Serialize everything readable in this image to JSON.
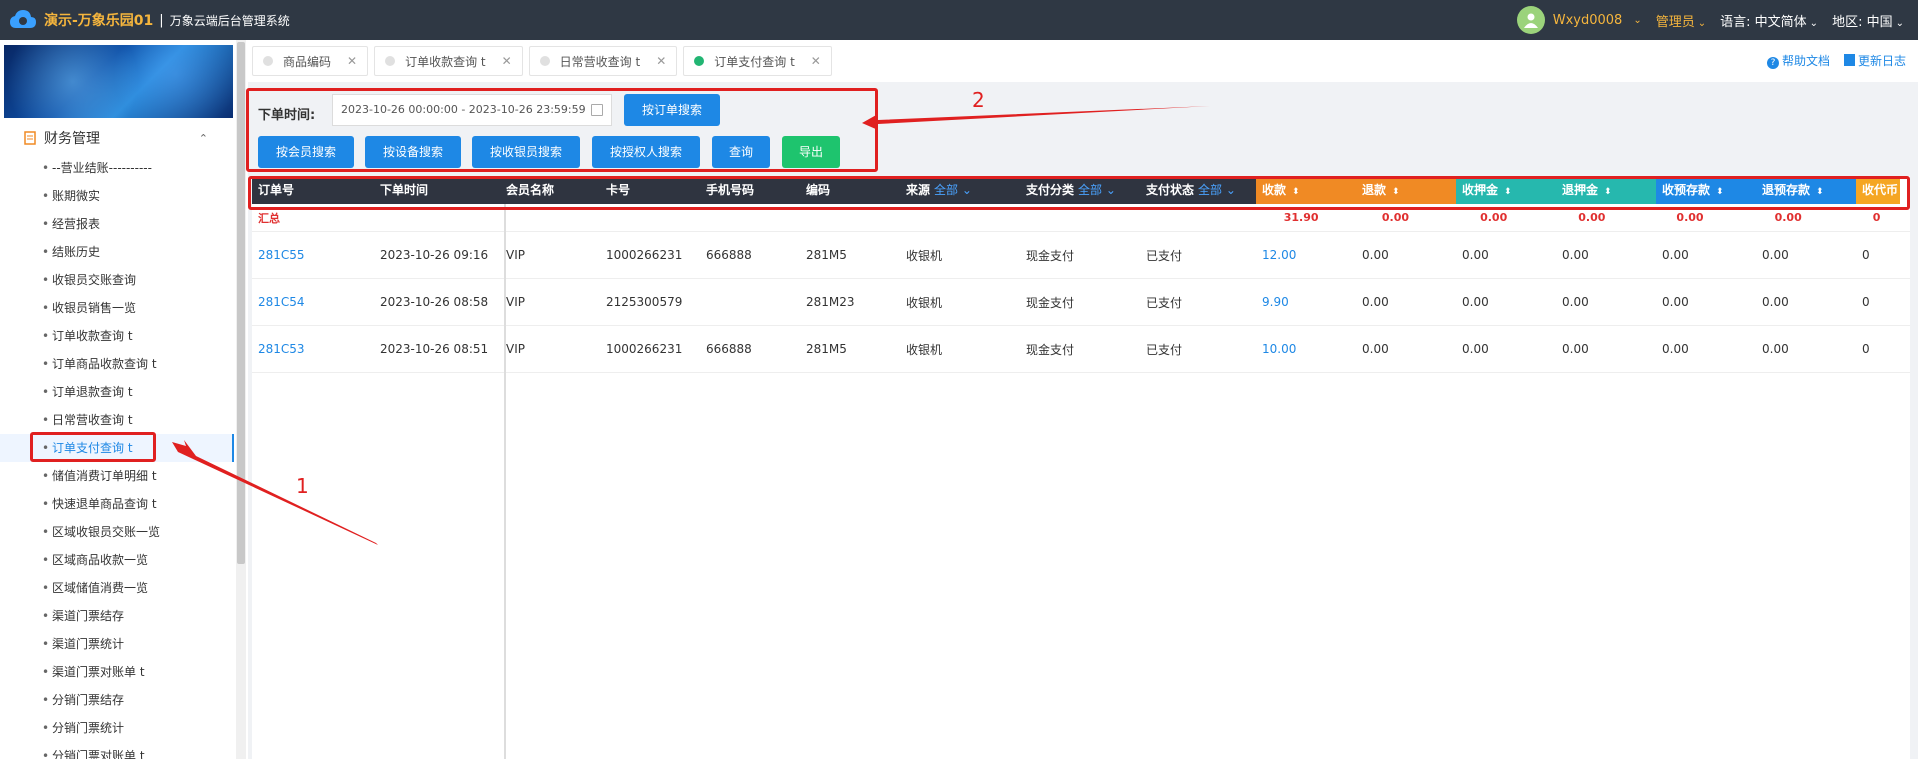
{
  "topbar": {
    "brand": "演示-万象乐园01",
    "separator": "|",
    "system_title": "万象云端后台管理系统",
    "username": "Wxyd0008",
    "role": "管理员",
    "language_label": "语言:",
    "language_value": "中文简体",
    "region_label": "地区:",
    "region_value": "中国"
  },
  "sidebar": {
    "section": "财务管理",
    "items": [
      "--营业结账----------",
      "账期微实",
      "经营报表",
      "结账历史",
      "收银员交账查询",
      "收银员销售一览",
      "订单收款查询 t",
      "订单商品收款查询 t",
      "订单退款查询 t",
      "日常营收查询 t",
      "订单支付查询 t",
      "储值消费订单明细 t",
      "快速退单商品查询 t",
      "区域收银员交账一览",
      "区域商品收款一览",
      "区域储值消费一览",
      "渠道门票结存",
      "渠道门票统计",
      "渠道门票对账单 t",
      "分销门票结存",
      "分销门票统计",
      "分销门票对账单 t"
    ]
  },
  "tabs": [
    "商品编码",
    "订单收款查询 t",
    "日常营收查询 t",
    "订单支付查询 t"
  ],
  "toplinks": {
    "help": "帮助文档",
    "changelog": "更新日志"
  },
  "filter": {
    "time_label": "下单时间:",
    "date_range": "2023-10-26 00:00:00 - 2023-10-26 23:59:59",
    "btn_order_search": "按订单搜索",
    "btn_member": "按会员搜索",
    "btn_device": "按设备搜索",
    "btn_cashier": "按收银员搜索",
    "btn_authorizer": "按授权人搜索",
    "btn_query": "查询",
    "btn_export": "导出"
  },
  "annotations": {
    "one": "1",
    "two": "2"
  },
  "table": {
    "headers": {
      "order_no": "订单号",
      "order_time": "下单时间",
      "member": "会员名称",
      "card": "卡号",
      "phone": "手机号码",
      "code": "编码",
      "source": "来源",
      "pay_type": "支付分类",
      "pay_status": "支付状态",
      "all": "全部",
      "receipt": "收款",
      "refund": "退款",
      "deposit_in": "收押金",
      "deposit_out": "退押金",
      "prepay_in": "收预存款",
      "prepay_out": "退预存款",
      "token_in": "收代币"
    },
    "summary": {
      "label": "汇总",
      "receipt": "31.90",
      "refund": "0.00",
      "deposit_in": "0.00",
      "deposit_out": "0.00",
      "prepay_in": "0.00",
      "prepay_out": "0.00",
      "token_in": "0"
    },
    "rows": [
      {
        "order_no": "281C55",
        "order_time": "2023-10-26 09:16",
        "member": "VIP",
        "card": "1000266231",
        "phone": "666888",
        "code": "281M5",
        "source": "收银机",
        "pay_type": "现金支付",
        "pay_status": "已支付",
        "receipt": "12.00",
        "refund": "0.00",
        "deposit_in": "0.00",
        "deposit_out": "0.00",
        "prepay_in": "0.00",
        "prepay_out": "0.00",
        "token_in": "0"
      },
      {
        "order_no": "281C54",
        "order_time": "2023-10-26 08:58",
        "member": "VIP",
        "card": "2125300579",
        "phone": "",
        "code": "281M23",
        "source": "收银机",
        "pay_type": "现金支付",
        "pay_status": "已支付",
        "receipt": "9.90",
        "refund": "0.00",
        "deposit_in": "0.00",
        "deposit_out": "0.00",
        "prepay_in": "0.00",
        "prepay_out": "0.00",
        "token_in": "0"
      },
      {
        "order_no": "281C53",
        "order_time": "2023-10-26 08:51",
        "member": "VIP",
        "card": "1000266231",
        "phone": "666888",
        "code": "281M5",
        "source": "收银机",
        "pay_type": "现金支付",
        "pay_status": "已支付",
        "receipt": "10.00",
        "refund": "0.00",
        "deposit_in": "0.00",
        "deposit_out": "0.00",
        "prepay_in": "0.00",
        "prepay_out": "0.00",
        "token_in": "0"
      }
    ]
  },
  "colors": {
    "accent": "#1e88e5",
    "topbar": "#2f3844",
    "brand": "#f5b53d",
    "annotation": "#e02020",
    "col_orange": "#f08a24",
    "col_teal": "#26b8ae",
    "col_blue": "#1e88e5",
    "col_dark": "#2f3440"
  }
}
